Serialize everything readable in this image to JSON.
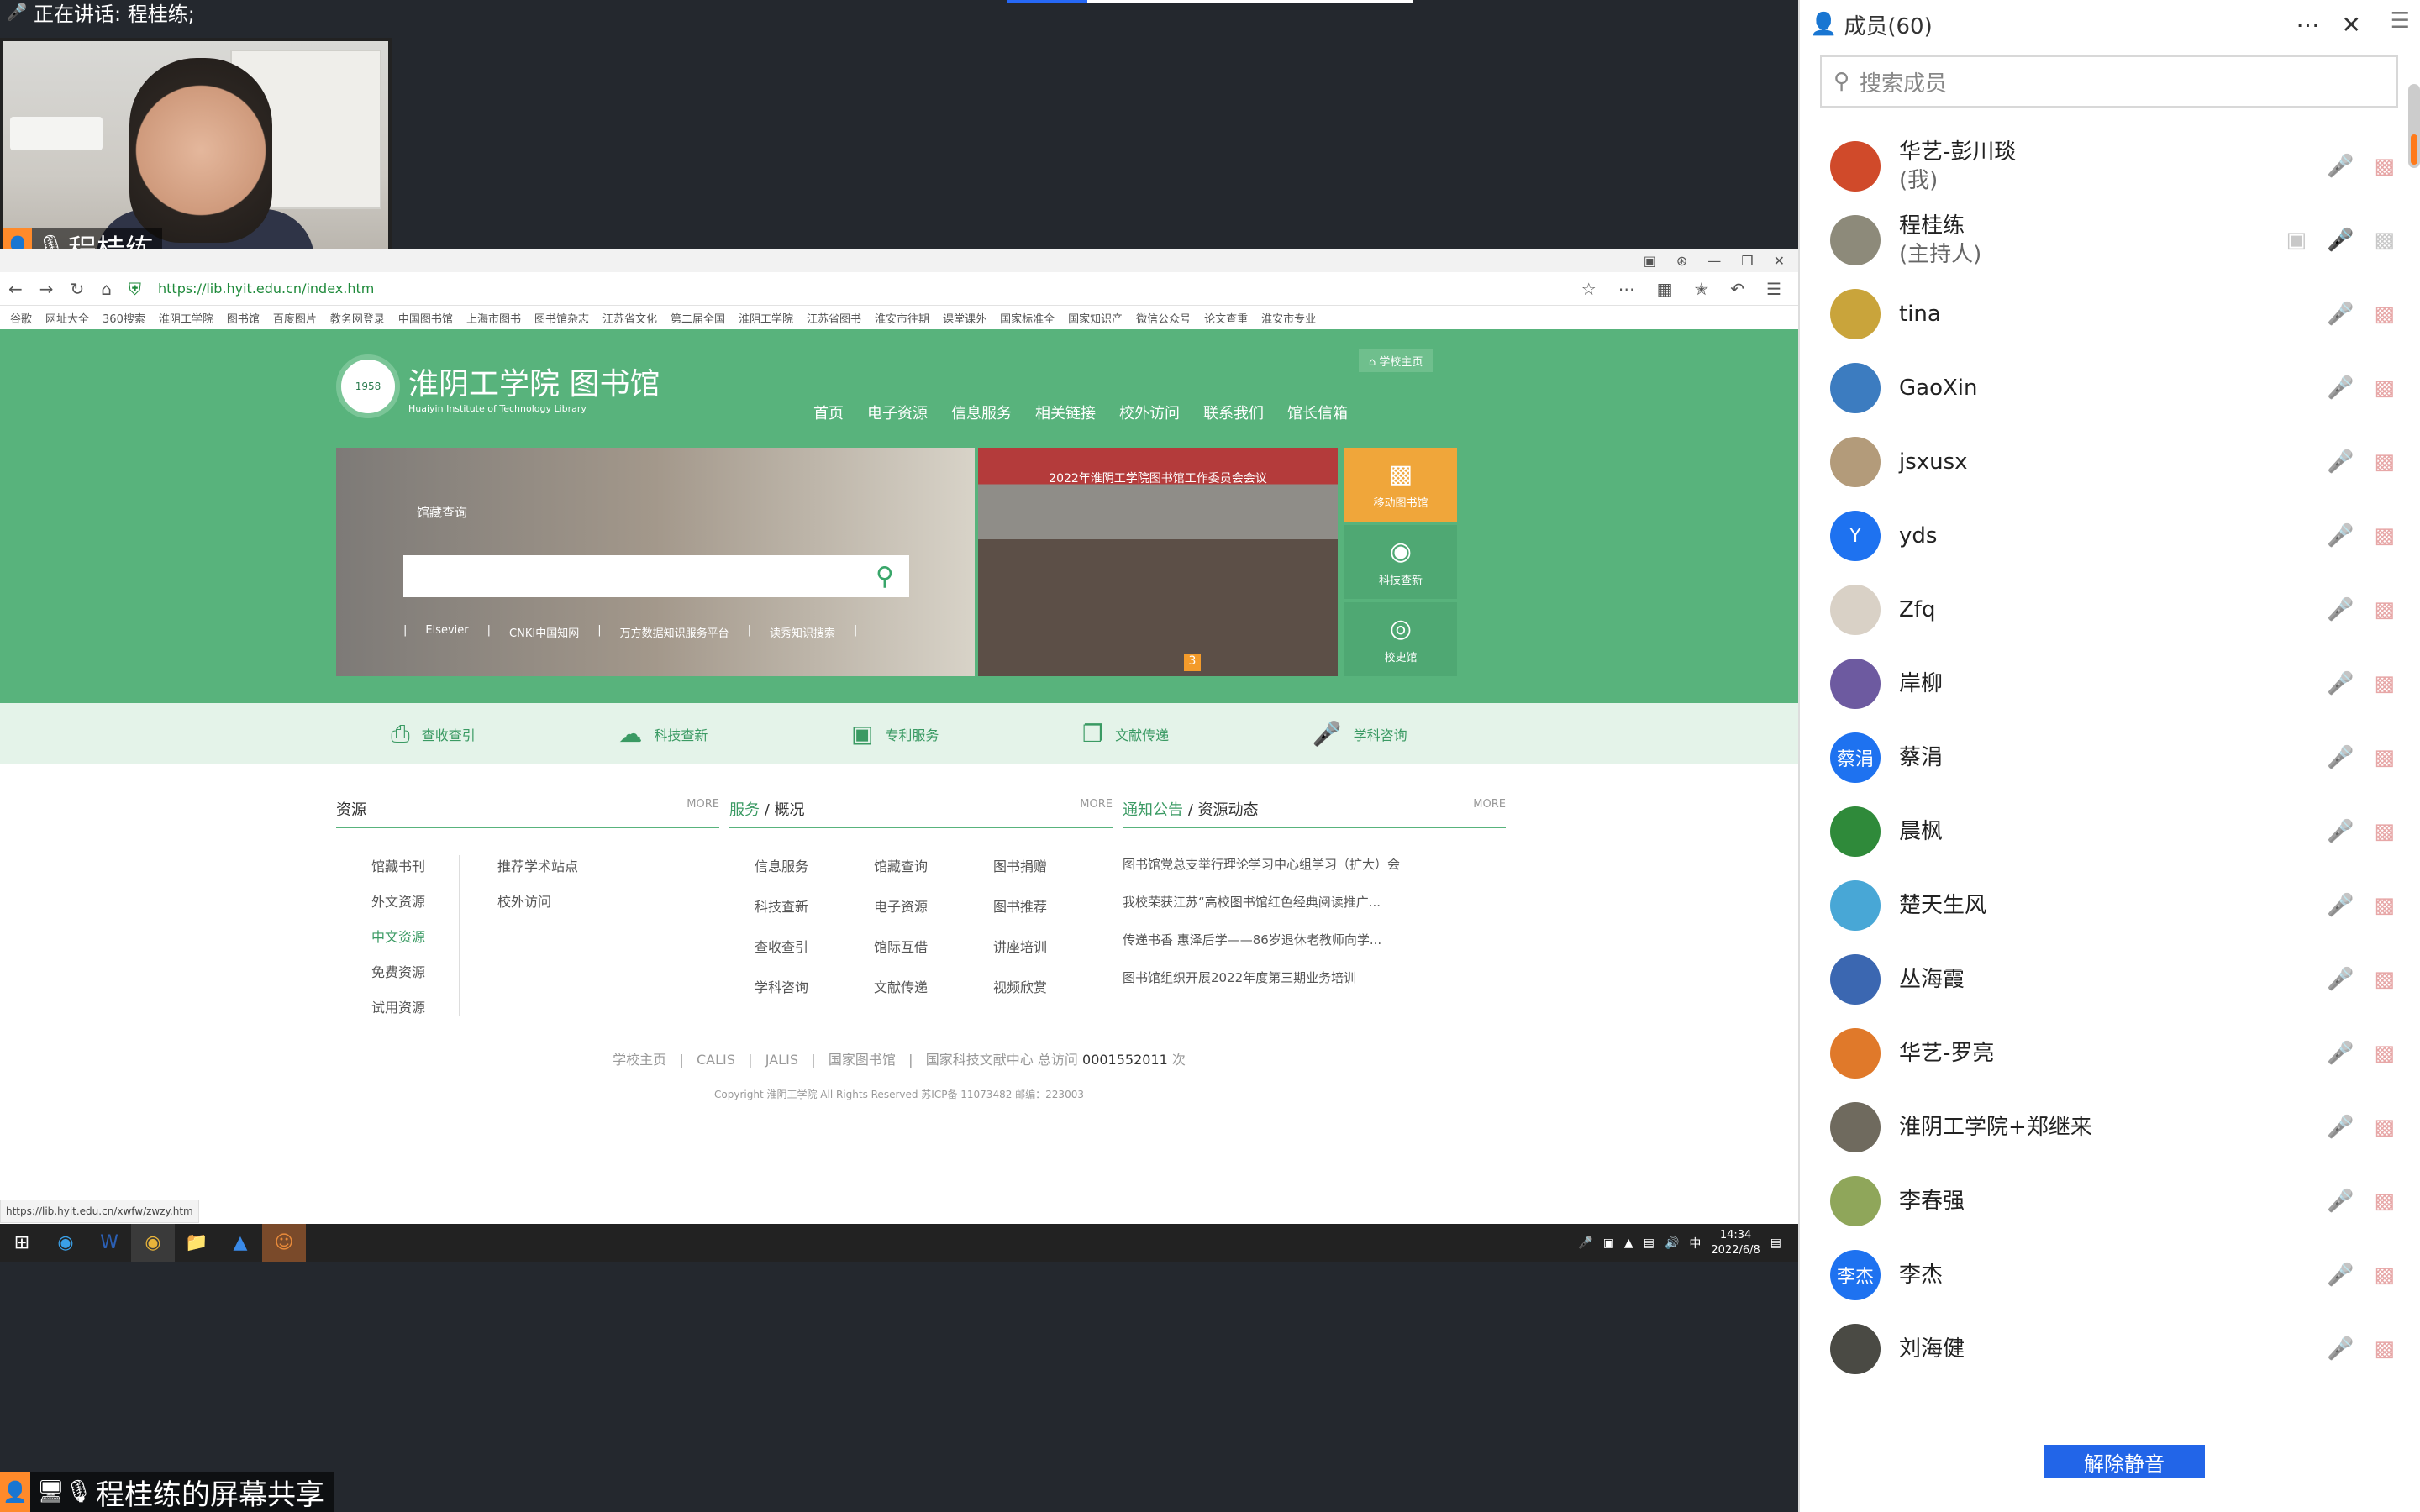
{
  "speaking": {
    "text": "正在讲话: 程桂练;"
  },
  "video": {
    "name": "程桂练"
  },
  "share_label": "程桂练的屏幕共享",
  "browser": {
    "url": "https://lib.hyit.edu.cn/index.htm",
    "bookmarks": [
      "谷歌",
      "网址大全",
      "360搜索",
      "淮阴工学院",
      "图书馆",
      "百度图片",
      "教务网登录",
      "中国图书馆",
      "上海市图书",
      "图书馆杂志",
      "江苏省文化",
      "第二届全国",
      "淮阴工学院",
      "江苏省图书",
      "淮安市往期",
      "课堂课外",
      "国家标准全",
      "国家知识产",
      "微信公众号",
      "论文查重",
      "淮安市专业"
    ],
    "status_url": "https://lib.hyit.edu.cn/xwfw/zwzy.htm"
  },
  "site": {
    "logo_title": "淮阴工学院 图书馆",
    "logo_sub": "Huaiyin Institute of Technology Library",
    "seal_text": "1958",
    "home_link": "学校主页",
    "nav": [
      "首页",
      "电子资源",
      "信息服务",
      "相关链接",
      "校外访问",
      "联系我们",
      "馆长信箱"
    ],
    "search_label": "馆藏查询",
    "search_links": [
      "Elsevier",
      "CNKI中国知网",
      "万方数据知识服务平台",
      "读秀知识搜索"
    ],
    "banner_text": "2022年淮阴工学院图书馆工作委员会会议",
    "banner_num": "3",
    "tiles": [
      {
        "label": "移动图书馆"
      },
      {
        "label": "科技查新"
      },
      {
        "label": "校史馆"
      }
    ],
    "services": [
      "查收查引",
      "科技查新",
      "专利服务",
      "文献传递",
      "学科咨询"
    ],
    "col1": {
      "title": "资源",
      "more": "MORE",
      "left": [
        "馆藏书刊",
        "外文资源",
        "中文资源",
        "免费资源",
        "试用资源"
      ],
      "right": [
        "推荐学术站点",
        "校外访问"
      ]
    },
    "col2": {
      "title_a": "服务",
      "title_b": "概况",
      "more": "MORE",
      "items": [
        "信息服务",
        "馆藏查询",
        "图书捐赠",
        "科技查新",
        "电子资源",
        "图书推荐",
        "查收查引",
        "馆际互借",
        "讲座培训",
        "学科咨询",
        "文献传递",
        "视频欣赏"
      ]
    },
    "col3": {
      "title_a": "通知公告",
      "title_b": "资源动态",
      "more": "MORE",
      "items": [
        "图书馆党总支举行理论学习中心组学习（扩大）会",
        "我校荣获江苏“高校图书馆红色经典阅读推广...",
        "传递书香 惠泽后学——86岁退休老教师向学...",
        "图书馆组织开展2022年度第三期业务培训"
      ]
    },
    "footer": {
      "links": [
        "学校主页",
        "CALIS",
        "JALIS",
        "国家图书馆",
        "国家科技文献中心"
      ],
      "visits_label": "总访问",
      "visits": "0001552011",
      "visits_unit": "次",
      "copyright": "Copyright 淮阴工学院   All Rights Reserved 苏ICP备 11073482   邮编：223003"
    }
  },
  "taskbar": {
    "time": "14:34",
    "date": "2022/6/8",
    "ime": "中"
  },
  "panel": {
    "title": "成员(60)",
    "search_placeholder": "搜索成员",
    "unmute": "解除静音",
    "members": [
      {
        "name": "华艺-彭川琰",
        "sub": "(我)",
        "avatar": "#d04a2a",
        "initial": ""
      },
      {
        "name": "程桂练",
        "sub": "(主持人)",
        "avatar": "#8d8a7a",
        "initial": ""
      },
      {
        "name": "tina",
        "sub": "",
        "avatar": "#c9a43b",
        "initial": ""
      },
      {
        "name": "GaoXin",
        "sub": "",
        "avatar": "#3c7cc0",
        "initial": ""
      },
      {
        "name": "jsxusx",
        "sub": "",
        "avatar": "#b39b7a",
        "initial": ""
      },
      {
        "name": "yds",
        "sub": "",
        "avatar": "#1e72f0",
        "initial": "Y"
      },
      {
        "name": "Zfq",
        "sub": "",
        "avatar": "#d9d1c6",
        "initial": ""
      },
      {
        "name": "岸柳",
        "sub": "",
        "avatar": "#6d5aa0",
        "initial": ""
      },
      {
        "name": "蔡涓",
        "sub": "",
        "avatar": "#1e72f0",
        "initial": "蔡涓"
      },
      {
        "name": "晨枫",
        "sub": "",
        "avatar": "#2f8a3a",
        "initial": ""
      },
      {
        "name": "楚天生风",
        "sub": "",
        "avatar": "#48a7d6",
        "initial": ""
      },
      {
        "name": "丛海霞",
        "sub": "",
        "avatar": "#3b67b1",
        "initial": ""
      },
      {
        "name": "华艺-罗亮",
        "sub": "",
        "avatar": "#e0792a",
        "initial": ""
      },
      {
        "name": "淮阴工学院+郑继来",
        "sub": "",
        "avatar": "#6f6a5e",
        "initial": ""
      },
      {
        "name": "李春强",
        "sub": "",
        "avatar": "#8fa65a",
        "initial": ""
      },
      {
        "name": "李杰",
        "sub": "",
        "avatar": "#1e72f0",
        "initial": "李杰"
      },
      {
        "name": "刘海健",
        "sub": "",
        "avatar": "#4a4a44",
        "initial": ""
      }
    ]
  }
}
